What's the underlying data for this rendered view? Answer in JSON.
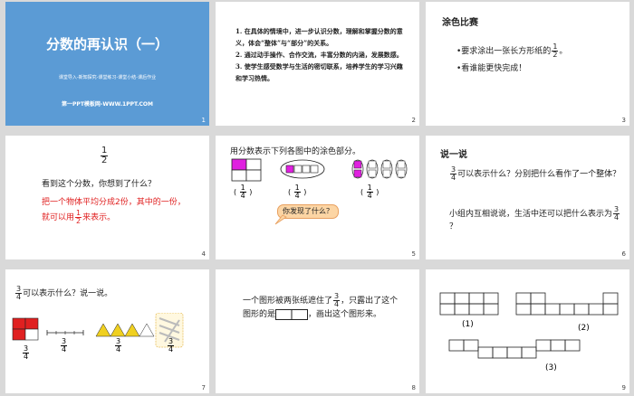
{
  "slides": [
    {
      "num": "1",
      "title": "分数的再认识（一）",
      "subtitle": "课堂导入-新知探究-课堂练习-课堂小结-课后作业",
      "footer": "第一PPT模板网-WWW.1PPT.COM"
    },
    {
      "num": "2",
      "items": [
        "1. 在具体的情境中，进一步认识分数，理解和掌握分数的意义，体会“整体”与“部分”的关系。",
        "2. 通过动手操作、合作交流，丰富分数的内涵，发展数感。",
        "3. 使学生感受数学与生活的密切联系，培养学生的学习兴趣和学习热情。"
      ]
    },
    {
      "num": "3",
      "title": "涂色比赛",
      "bullet1_pre": "•要求涂出一张长方形纸的",
      "bullet1_num": "1",
      "bullet1_den": "2",
      "bullet1_post": "。",
      "bullet2": "•看谁能更快完成！"
    },
    {
      "num": "4",
      "frac_num": "1",
      "frac_den": "2",
      "question": "看到这个分数，你想到了什么？",
      "red1": "把一个物体平均分成2份，其中的一份，",
      "red2_pre": "就可以用",
      "red2_num": "1",
      "red2_den": "2",
      "red2_post": "来表示。"
    },
    {
      "num": "5",
      "prompt": "用分数表示下列各图中的涂色部分。",
      "f1n": "1",
      "f1d": "4",
      "f2n": "1",
      "f2d": "4",
      "f3n": "1",
      "f3d": "4",
      "bubble": "你发现了什么？"
    },
    {
      "num": "6",
      "title": "说一说",
      "q1_num": "3",
      "q1_den": "4",
      "q1_text": "可以表示什么？分别把什么看作了一个整体？",
      "q2_pre": "小组内互相说说，生活中还可以把什么表示为",
      "q2_num": "3",
      "q2_den": "4",
      "q2_post": "？"
    },
    {
      "num": "7",
      "head_num": "3",
      "head_den": "4",
      "head_text": "可以表示什么？说一说。",
      "l1n": "3",
      "l1d": "4",
      "l2n": "3",
      "l2d": "4",
      "l3n": "3",
      "l3d": "4",
      "l4n": "3",
      "l4d": "4"
    },
    {
      "num": "8",
      "text1": "一个图形被两张纸遮住了",
      "frac_num": "3",
      "frac_den": "4",
      "text2": "，只露出了这个图形的是",
      "text3": "，画出这个图形来。"
    },
    {
      "num": "9",
      "label1": "(1)",
      "label2": "(2)",
      "label3": "(3)"
    }
  ]
}
